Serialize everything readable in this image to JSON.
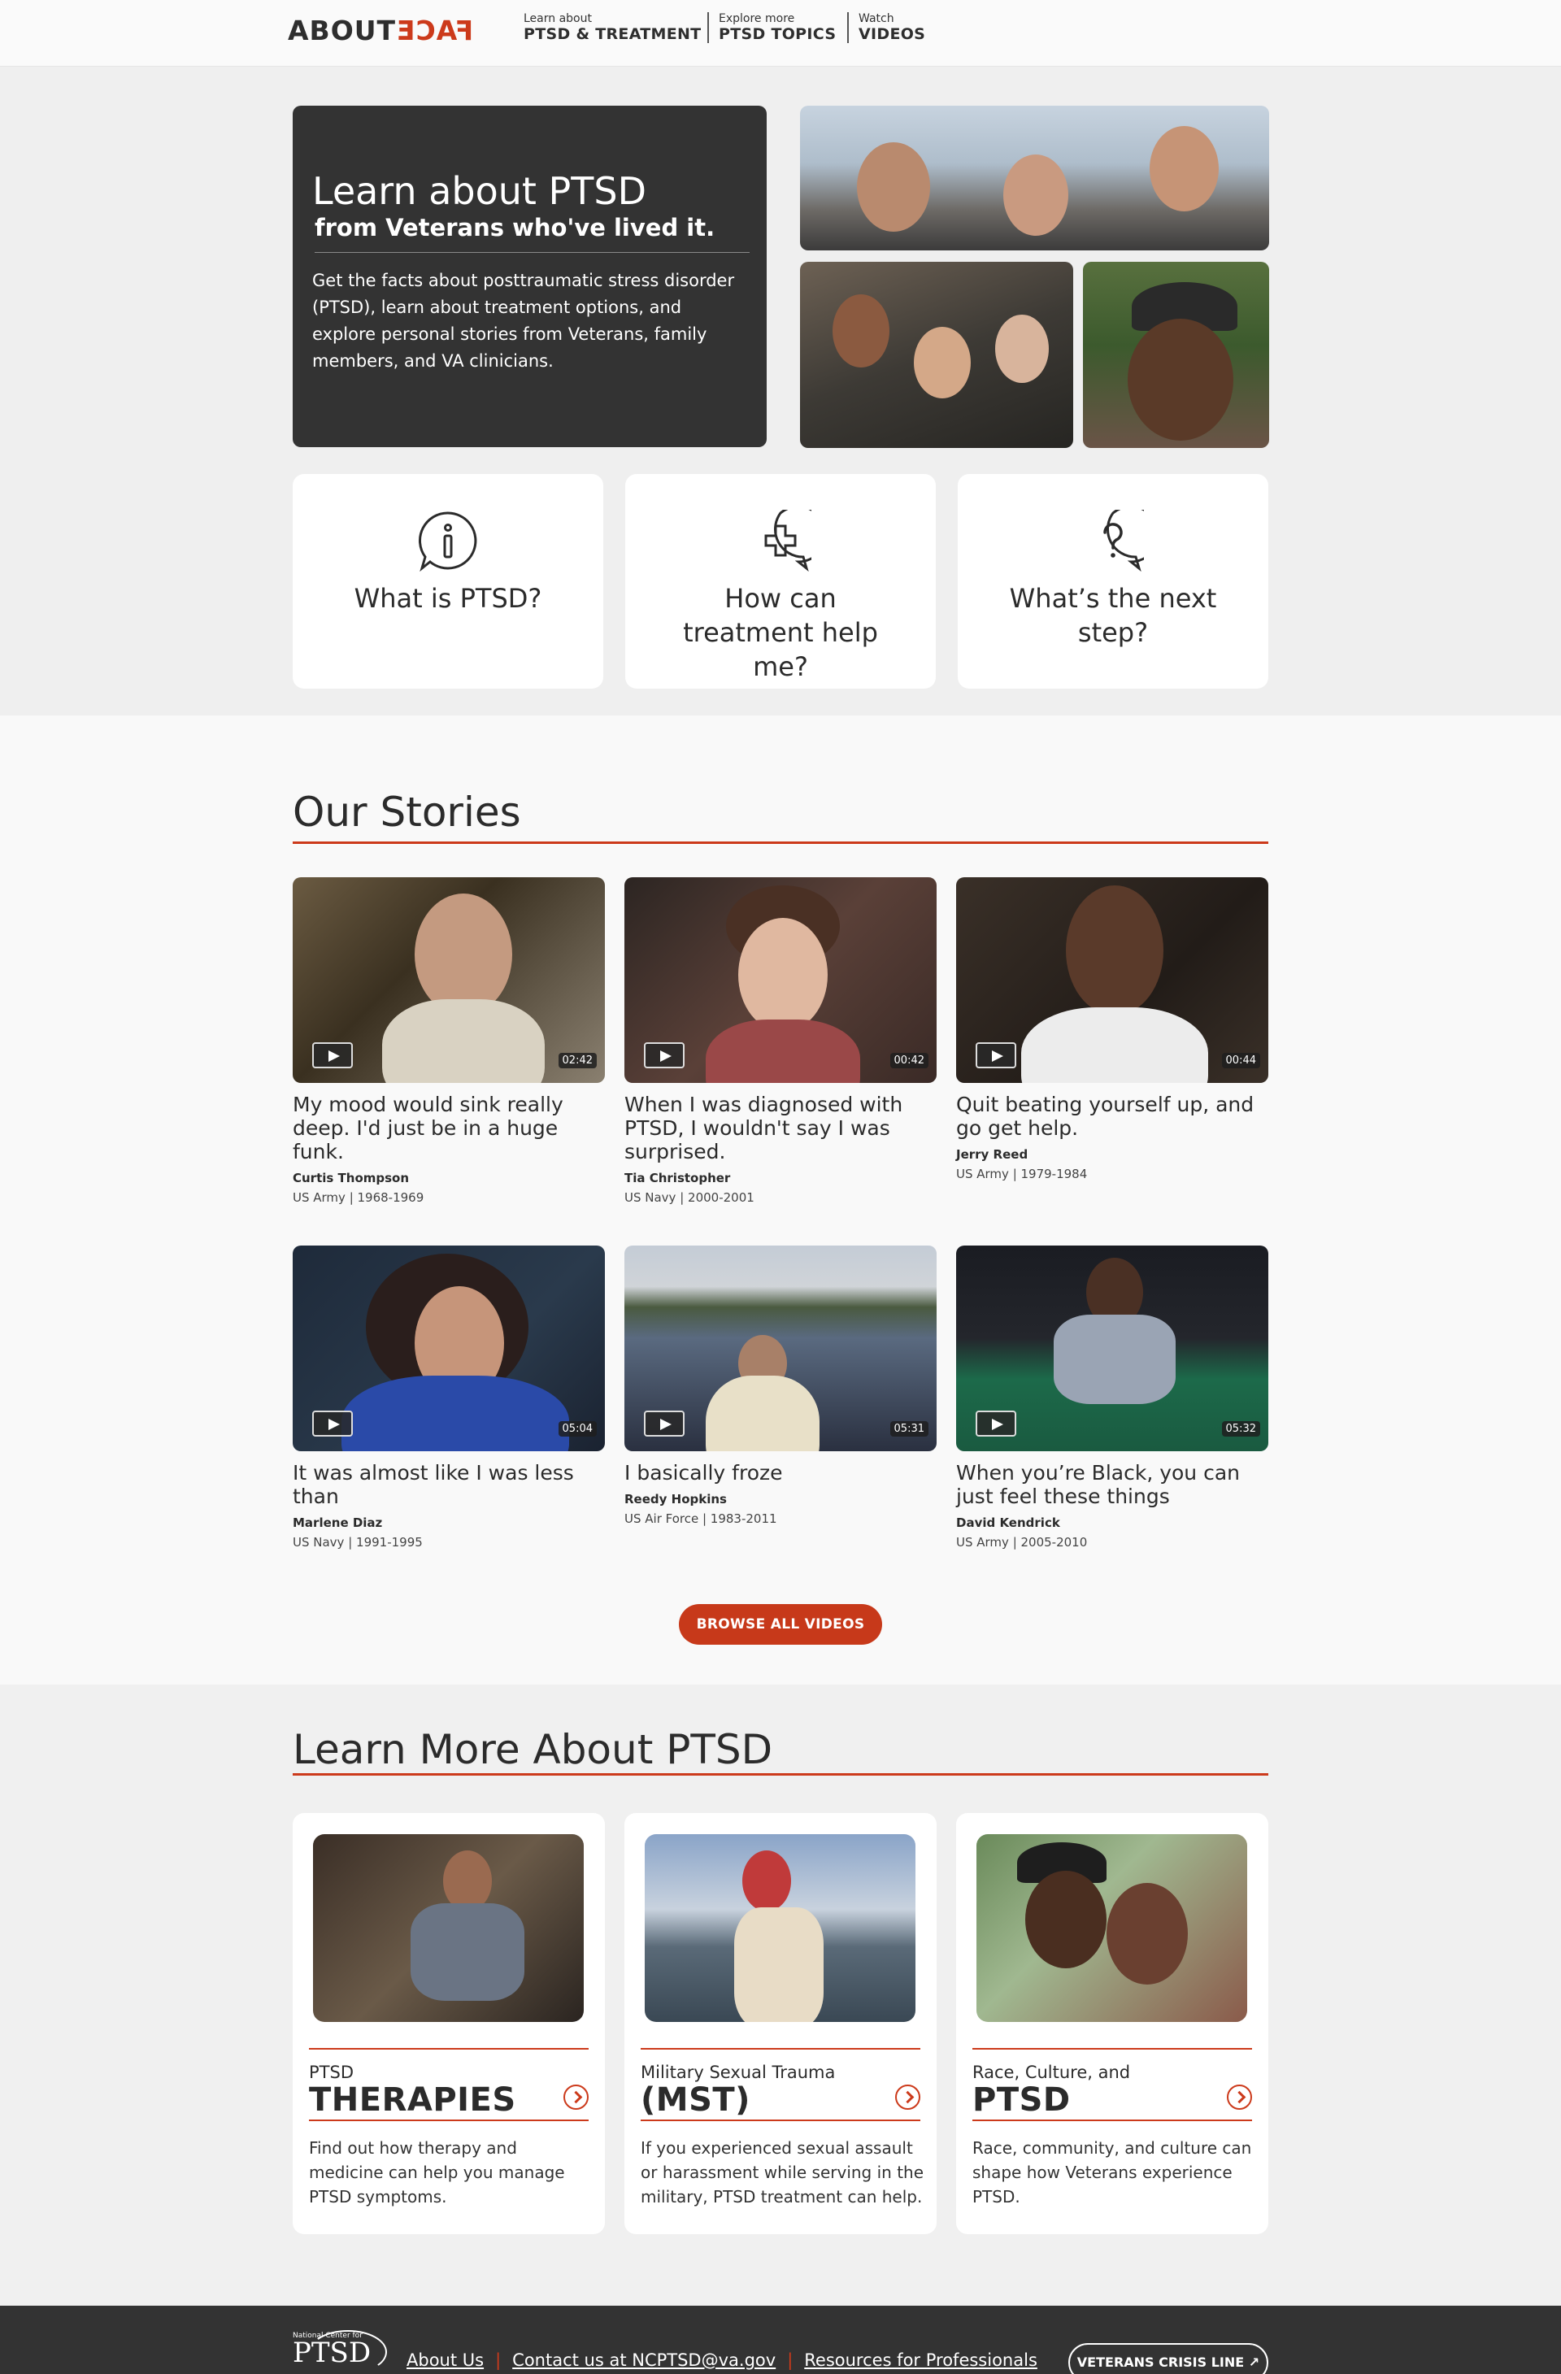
{
  "nav": {
    "logo_about": "ABOUT",
    "logo_face": "FACE",
    "items": [
      {
        "small": "Learn about",
        "big": "PTSD & TREATMENT"
      },
      {
        "small": "Explore more",
        "big": "PTSD TOPICS"
      },
      {
        "small": "Watch",
        "big": "VIDEOS"
      }
    ]
  },
  "hero": {
    "title": "Learn about PTSD",
    "subtitle": "from Veterans who've lived it.",
    "text": "Get the facts about posttraumatic stress disorder (PTSD), learn about treatment options, and explore personal stories from Veterans, family members, and VA clinicians."
  },
  "cards": [
    {
      "label": "What is PTSD?",
      "icon": "info-bubble-icon"
    },
    {
      "label": "How can treatment help me?",
      "icon": "plus-bubble-icon"
    },
    {
      "label": "What’s the next step?",
      "icon": "question-bubble-icon"
    }
  ],
  "stories": {
    "title": "Our Stories",
    "items": [
      {
        "quote": "My mood would sink really deep. I'd just be in a huge funk.",
        "name": "Curtis Thompson",
        "branch": "US Army | 1968-1969",
        "duration": "02:42"
      },
      {
        "quote": "When I was diagnosed with PTSD, I wouldn't say I was surprised.",
        "name": "Tia Christopher",
        "branch": "US Navy | 2000-2001",
        "duration": "00:42"
      },
      {
        "quote": "Quit beating yourself up, and go get help.",
        "name": "Jerry Reed",
        "branch": "US Army | 1979-1984",
        "duration": "00:44"
      },
      {
        "quote": "It was almost like I was less than",
        "name": "Marlene Diaz",
        "branch": "US Navy | 1991-1995",
        "duration": "05:04"
      },
      {
        "quote": "I basically froze",
        "name": "Reedy Hopkins",
        "branch": "US Air Force | 1983-2011",
        "duration": "05:31"
      },
      {
        "quote": "When you’re Black, you can just feel these things",
        "name": "David Kendrick",
        "branch": "US Army | 2005-2010",
        "duration": "05:32"
      }
    ],
    "browse_label": "BROWSE ALL VIDEOS"
  },
  "learn_more": {
    "title": "Learn More About PTSD",
    "items": [
      {
        "small": "PTSD",
        "big": "THERAPIES",
        "text": "Find out how therapy and medicine can help you manage PTSD symptoms."
      },
      {
        "small": "Military Sexual Trauma",
        "big": "(MST)",
        "text": "If you experienced sexual assault or harassment while serving in the military, PTSD treatment can help."
      },
      {
        "small": "Race, Culture, and",
        "big": "PTSD",
        "text": "Race, community, and culture can shape how Veterans experience PTSD."
      }
    ]
  },
  "footer": {
    "logo_small": "National Center for",
    "logo_big": "PTSD",
    "links": [
      "About Us",
      "Contact us at NCPTSD@va.gov",
      "Resources for Professionals"
    ],
    "crisis_label": "VETERANS CRISIS LINE"
  },
  "colors": {
    "accent": "#cc3a1b",
    "dark": "#333333"
  }
}
